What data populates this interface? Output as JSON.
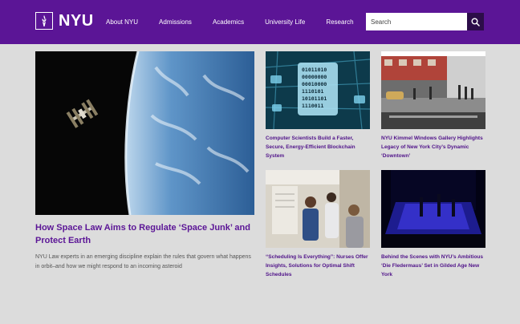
{
  "header": {
    "logo_text": "NYU",
    "nav": [
      "About NYU",
      "Admissions",
      "Academics",
      "University Life",
      "Research"
    ],
    "search_placeholder": "Search"
  },
  "feature": {
    "title": "How Space Law Aims to Regulate ‘Space Junk’ and Protect Earth",
    "description": "NYU Law experts in an emerging discipline explain the rules that govern what happens in orbit–and how we might respond to an incoming asteroid"
  },
  "cards": [
    {
      "title": "Computer Scientists Build a Faster, Secure, Energy-Efficient Blockchain System",
      "binary_text": [
        "01011010",
        "00000000",
        "00010000",
        "1110101",
        "10101101",
        "1110011"
      ]
    },
    {
      "title": "NYU Kimmel Windows Gallery Highlights Legacy of New York City’s Dynamic ‘Downtown’"
    },
    {
      "title": "“Scheduling Is Everything”: Nurses Offer Insights, Solutions for Optimal Shift Schedules"
    },
    {
      "title": "Behind the Scenes with NYU’s Ambitious ‘Die Fledermaus’ Set in Gilded Age New York"
    }
  ],
  "colors": {
    "brand": "#5b1596",
    "background": "#dcdcdc",
    "search_button": "#2c0d49"
  }
}
